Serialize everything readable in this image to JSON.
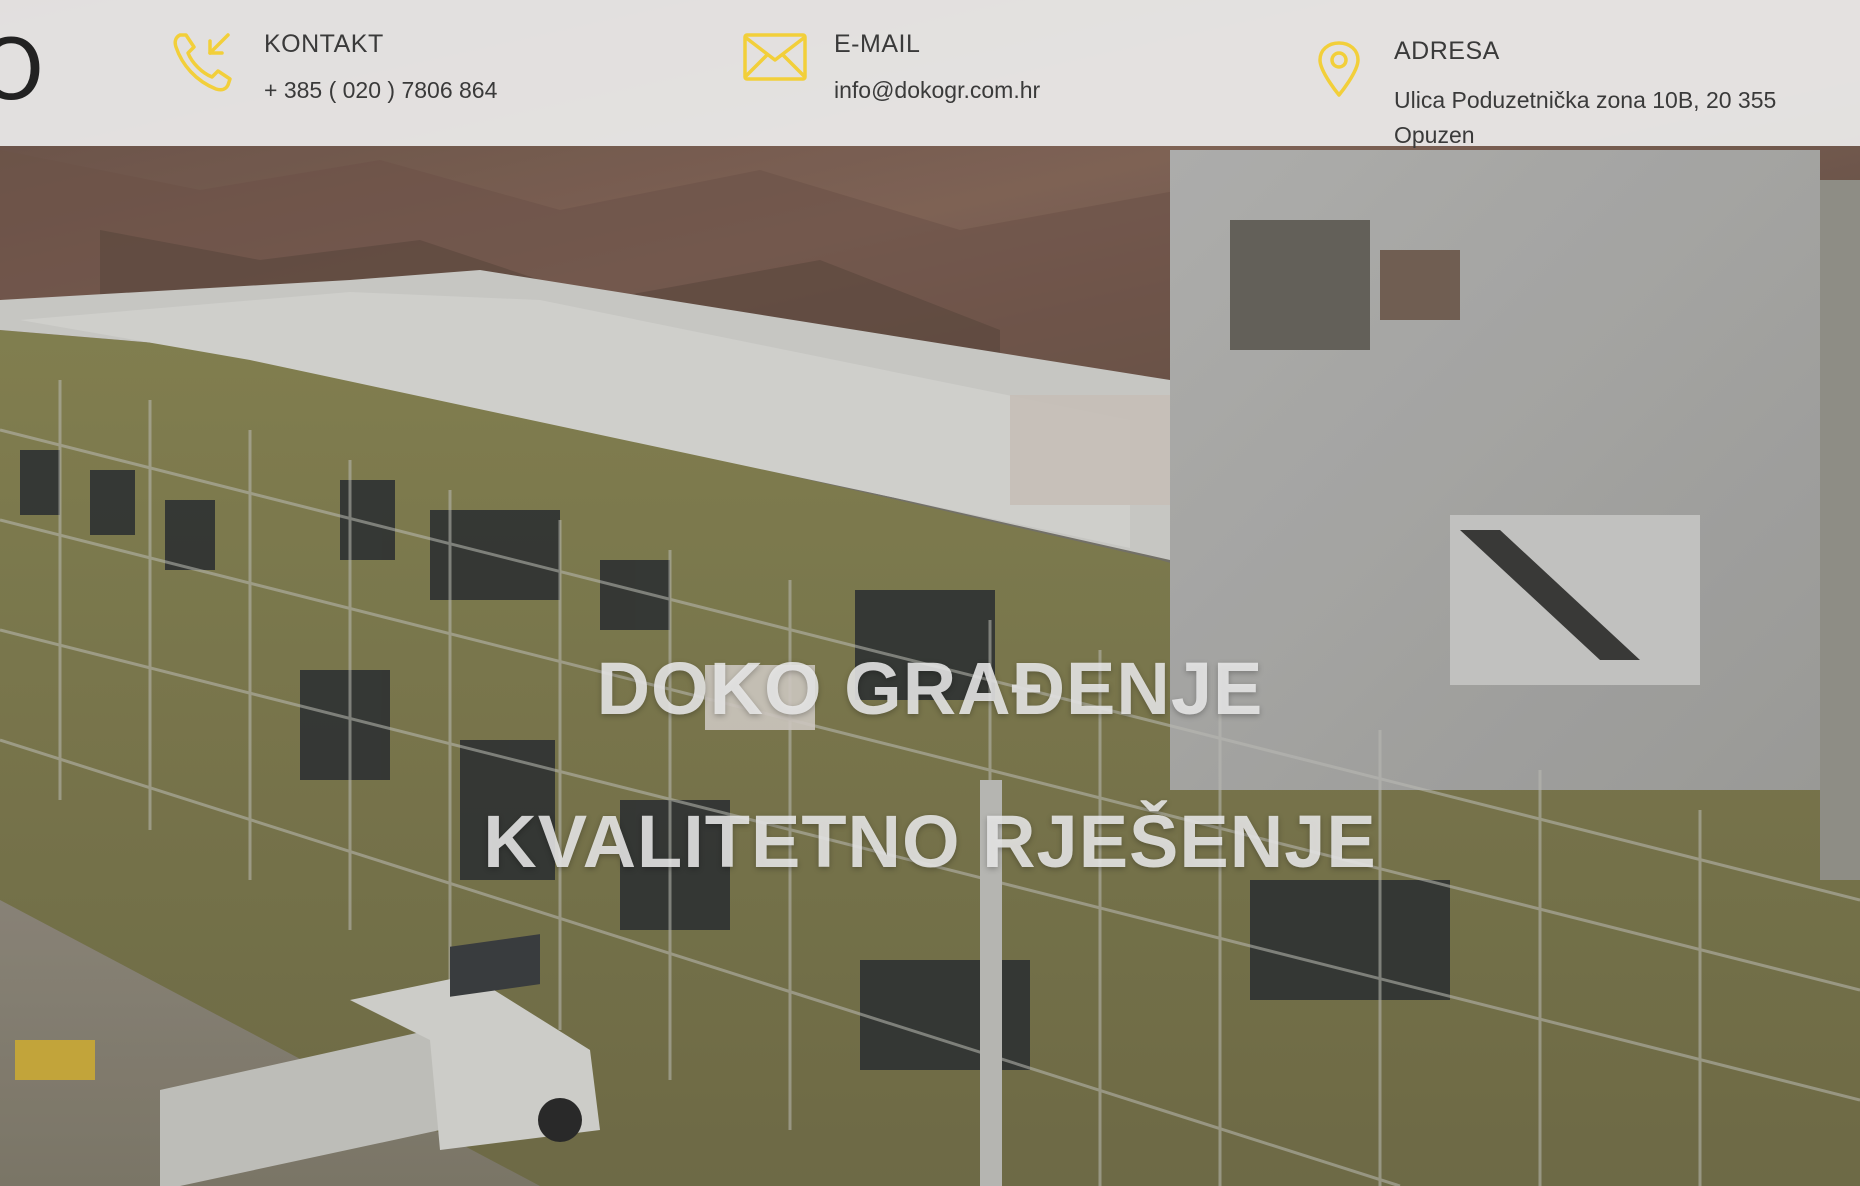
{
  "colors": {
    "accent_icon": "#f2cf3a",
    "topbar_bg": "#f0f0f0",
    "text_dark": "#3a3a3a",
    "headline_text": "#e8e8e8"
  },
  "header": {
    "logo_fragment": "O",
    "contact": {
      "icon": "phone-icon",
      "label": "KONTAKT",
      "value": "+ 385 ( 020 ) 7806 864"
    },
    "email": {
      "icon": "mail-icon",
      "label": "E-MAIL",
      "value": "info@dokogr.com.hr"
    },
    "address": {
      "icon": "location-pin-icon",
      "label": "ADRESA",
      "value": "Ulica Poduzetnička zona 10B, 20 355 Opuzen"
    }
  },
  "hero": {
    "headline_line1": "DOKO GRAĐENJE",
    "headline_line2": "KVALITETNO RJEŠENJE"
  }
}
